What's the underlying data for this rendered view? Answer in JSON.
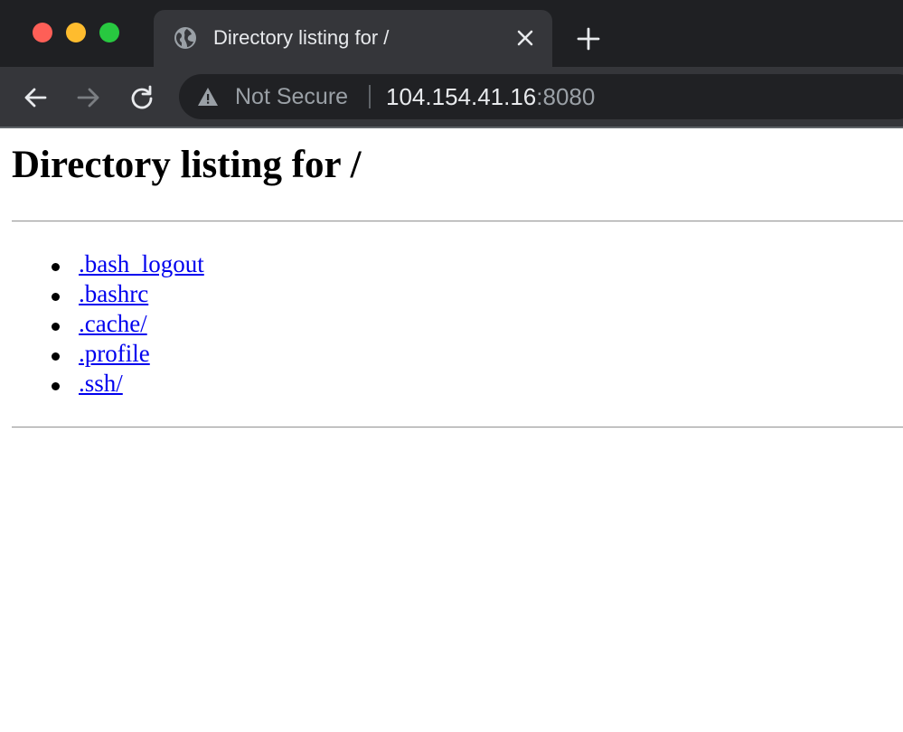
{
  "browser": {
    "tab_title": "Directory listing for /",
    "security_label": "Not Secure",
    "url_host": "104.154.41.16",
    "url_port": ":8080",
    "icons": {
      "tab_favicon": "globe-icon",
      "tab_close": "close-icon",
      "new_tab": "plus-icon",
      "back": "arrow-left-icon",
      "forward": "arrow-right-icon",
      "reload": "reload-icon",
      "security": "warning-icon"
    },
    "colors": {
      "window_close": "#fe5f57",
      "window_minimize": "#febc2e",
      "window_zoom": "#28c840",
      "chrome_dark": "#1f2023",
      "chrome_toolbar": "#35363a"
    }
  },
  "page": {
    "heading": "Directory listing for /",
    "entries": [
      {
        "label": ".bash_logout"
      },
      {
        "label": ".bashrc"
      },
      {
        "label": ".cache/"
      },
      {
        "label": ".profile"
      },
      {
        "label": ".ssh/"
      }
    ],
    "colors": {
      "link": "#0000ee"
    }
  }
}
